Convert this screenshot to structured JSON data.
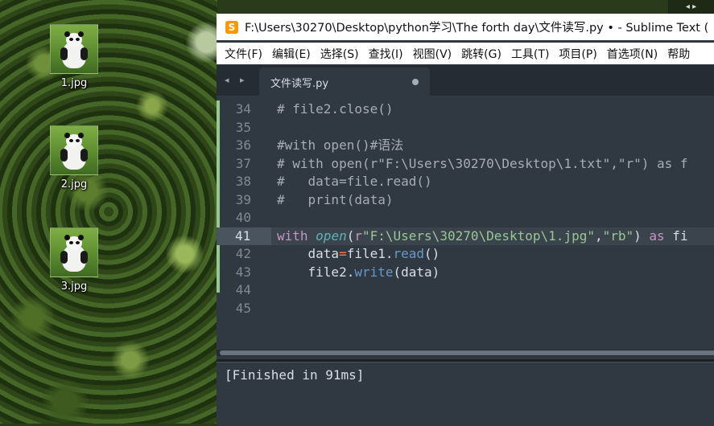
{
  "desktop": {
    "icons": [
      {
        "label": "1.jpg"
      },
      {
        "label": "2.jpg"
      },
      {
        "label": "3.jpg"
      }
    ],
    "corner_controls": "◂ ▸"
  },
  "window": {
    "title": "F:\\Users\\30270\\Desktop\\python学习\\The forth day\\文件读写.py • - Sublime Text (",
    "app_icon": "S",
    "menu": [
      "文件(F)",
      "编辑(E)",
      "选择(S)",
      "查找(I)",
      "视图(V)",
      "跳转(G)",
      "工具(T)",
      "项目(P)",
      "首选项(N)",
      "帮助"
    ],
    "tab_nav": "◂ ▸",
    "tab": {
      "label": "文件读写.py"
    },
    "output": "[Finished in 91ms]"
  },
  "editor": {
    "active_line": 41,
    "lines": [
      {
        "n": "34",
        "text": "# file2.close()"
      },
      {
        "n": "35",
        "text": ""
      },
      {
        "n": "36",
        "text": "#with open()#语法"
      },
      {
        "n": "37",
        "text": "# with open(r\"F:\\Users\\30270\\Desktop\\1.txt\",\"r\") as f"
      },
      {
        "n": "38",
        "text": "#   data=file.read()"
      },
      {
        "n": "39",
        "text": "#   print(data)"
      },
      {
        "n": "40",
        "text": ""
      },
      {
        "n": "41",
        "text": "with open(r\"F:\\Users\\30270\\Desktop\\1.jpg\",\"rb\") as fi"
      },
      {
        "n": "42",
        "text": "    data=file1.read()"
      },
      {
        "n": "43",
        "text": "    file2.write(data)"
      },
      {
        "n": "44",
        "text": ""
      },
      {
        "n": "45",
        "text": ""
      }
    ]
  },
  "colors": {
    "editor_bg": "#303841",
    "comment": "#a6acb9",
    "keyword": "#c594c5",
    "function": "#5fb3b3",
    "string": "#99c794",
    "operator": "#f97b58",
    "method": "#6699cc",
    "app_accent": "#ff9800"
  }
}
